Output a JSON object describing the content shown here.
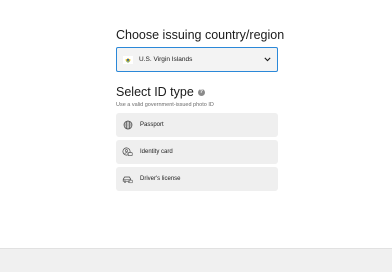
{
  "country": {
    "heading": "Choose issuing country/region",
    "selected": "U.S. Virgin Islands",
    "flag_icon": "usvi-flag-icon",
    "dropdown_icon": "chevron-down-icon"
  },
  "id_type": {
    "heading": "Select ID type",
    "help_glyph": "?",
    "subtitle": "Use a valid government-issued photo ID",
    "options": [
      {
        "label": "Passport",
        "icon": "globe-icon"
      },
      {
        "label": "Identity card",
        "icon": "id-card-icon"
      },
      {
        "label": "Driver's license",
        "icon": "car-icon"
      }
    ]
  },
  "colors": {
    "accent_border": "#2b88d8",
    "option_bg": "#efefef",
    "footer_bg": "#f0f0f0"
  }
}
